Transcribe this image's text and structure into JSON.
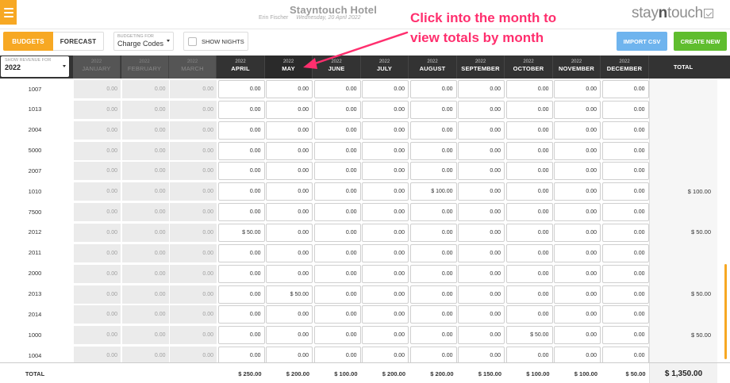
{
  "header": {
    "hotel_name": "Stayntouch Hotel",
    "user_name": "Erin Fischer",
    "date": "Wednesday, 20 April 2022",
    "logo_pre": "stay",
    "logo_bold": "n",
    "logo_post": "touch"
  },
  "annotation": {
    "line1": "Click into the month to",
    "line2": "view totals by month"
  },
  "toolbar": {
    "budgets_label": "BUDGETS",
    "forecast_label": "FORECAST",
    "budgeting_for_label": "BUDGETING FOR",
    "budgeting_for_value": "Charge Codes",
    "show_nights_label": "SHOW NIGHTS",
    "import_label": "IMPORT CSV",
    "create_label": "CREATE NEW"
  },
  "revenue_select": {
    "label": "SHOW REVENUE FOR",
    "value": "2022"
  },
  "months": [
    {
      "year": "2022",
      "name": "JANUARY"
    },
    {
      "year": "2022",
      "name": "FEBRUARY"
    },
    {
      "year": "2022",
      "name": "MARCH"
    },
    {
      "year": "2022",
      "name": "APRIL"
    },
    {
      "year": "2022",
      "name": "MAY"
    },
    {
      "year": "2022",
      "name": "JUNE"
    },
    {
      "year": "2022",
      "name": "JULY"
    },
    {
      "year": "2022",
      "name": "AUGUST"
    },
    {
      "year": "2022",
      "name": "SEPTEMBER"
    },
    {
      "year": "2022",
      "name": "OCTOBER"
    },
    {
      "year": "2022",
      "name": "NOVEMBER"
    },
    {
      "year": "2022",
      "name": "DECEMBER"
    }
  ],
  "total_header": "TOTAL",
  "rows": [
    {
      "code": "1007",
      "values": [
        "0.00",
        "0.00",
        "0.00",
        "0.00",
        "0.00",
        "0.00",
        "0.00",
        "0.00",
        "0.00",
        "0.00",
        "0.00",
        "0.00"
      ],
      "total": ""
    },
    {
      "code": "1013",
      "values": [
        "0.00",
        "0.00",
        "0.00",
        "0.00",
        "0.00",
        "0.00",
        "0.00",
        "0.00",
        "0.00",
        "0.00",
        "0.00",
        "0.00"
      ],
      "total": ""
    },
    {
      "code": "2004",
      "values": [
        "0.00",
        "0.00",
        "0.00",
        "0.00",
        "0.00",
        "0.00",
        "0.00",
        "0.00",
        "0.00",
        "0.00",
        "0.00",
        "0.00"
      ],
      "total": ""
    },
    {
      "code": "5000",
      "values": [
        "0.00",
        "0.00",
        "0.00",
        "0.00",
        "0.00",
        "0.00",
        "0.00",
        "0.00",
        "0.00",
        "0.00",
        "0.00",
        "0.00"
      ],
      "total": ""
    },
    {
      "code": "2007",
      "values": [
        "0.00",
        "0.00",
        "0.00",
        "0.00",
        "0.00",
        "0.00",
        "0.00",
        "0.00",
        "0.00",
        "0.00",
        "0.00",
        "0.00"
      ],
      "total": ""
    },
    {
      "code": "1010",
      "values": [
        "0.00",
        "0.00",
        "0.00",
        "0.00",
        "0.00",
        "0.00",
        "0.00",
        "$ 100.00",
        "0.00",
        "0.00",
        "0.00",
        "0.00"
      ],
      "total": "$ 100.00"
    },
    {
      "code": "7500",
      "values": [
        "0.00",
        "0.00",
        "0.00",
        "0.00",
        "0.00",
        "0.00",
        "0.00",
        "0.00",
        "0.00",
        "0.00",
        "0.00",
        "0.00"
      ],
      "total": ""
    },
    {
      "code": "2012",
      "values": [
        "0.00",
        "0.00",
        "0.00",
        "$ 50.00",
        "0.00",
        "0.00",
        "0.00",
        "0.00",
        "0.00",
        "0.00",
        "0.00",
        "0.00"
      ],
      "total": "$ 50.00"
    },
    {
      "code": "2011",
      "values": [
        "0.00",
        "0.00",
        "0.00",
        "0.00",
        "0.00",
        "0.00",
        "0.00",
        "0.00",
        "0.00",
        "0.00",
        "0.00",
        "0.00"
      ],
      "total": ""
    },
    {
      "code": "2000",
      "values": [
        "0.00",
        "0.00",
        "0.00",
        "0.00",
        "0.00",
        "0.00",
        "0.00",
        "0.00",
        "0.00",
        "0.00",
        "0.00",
        "0.00"
      ],
      "total": ""
    },
    {
      "code": "2013",
      "values": [
        "0.00",
        "0.00",
        "0.00",
        "0.00",
        "$ 50.00",
        "0.00",
        "0.00",
        "0.00",
        "0.00",
        "0.00",
        "0.00",
        "0.00"
      ],
      "total": "$ 50.00"
    },
    {
      "code": "2014",
      "values": [
        "0.00",
        "0.00",
        "0.00",
        "0.00",
        "0.00",
        "0.00",
        "0.00",
        "0.00",
        "0.00",
        "0.00",
        "0.00",
        "0.00"
      ],
      "total": ""
    },
    {
      "code": "1000",
      "values": [
        "0.00",
        "0.00",
        "0.00",
        "0.00",
        "0.00",
        "0.00",
        "0.00",
        "0.00",
        "0.00",
        "$ 50.00",
        "0.00",
        "0.00"
      ],
      "total": "$ 50.00"
    },
    {
      "code": "1004",
      "values": [
        "0.00",
        "0.00",
        "0.00",
        "0.00",
        "0.00",
        "0.00",
        "0.00",
        "0.00",
        "0.00",
        "0.00",
        "0.00",
        "0.00"
      ],
      "total": ""
    }
  ],
  "footer": {
    "label": "TOTAL",
    "values": [
      "$ 250.00",
      "$ 200.00",
      "$ 100.00",
      "$ 200.00",
      "$ 200.00",
      "$ 150.00",
      "$ 100.00",
      "$ 100.00",
      "$ 50.00"
    ],
    "grand_total": "$ 1,350.00"
  },
  "colors": {
    "accent": "#f7a823",
    "annotation": "#ff2f6e",
    "import": "#6fb4ee",
    "create": "#5fbd2e",
    "header_dark": "#333333"
  }
}
